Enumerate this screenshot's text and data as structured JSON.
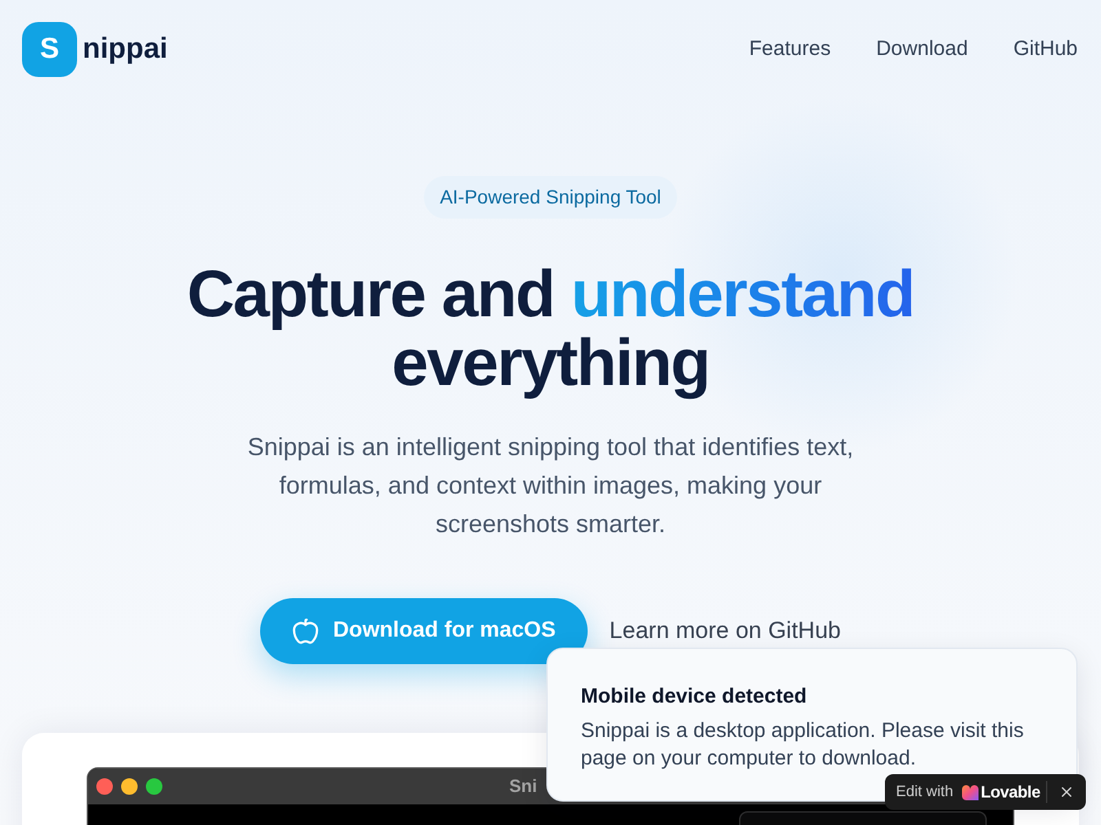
{
  "header": {
    "logo": {
      "mark": "S",
      "name": "nippai"
    },
    "nav": [
      "Features",
      "Download",
      "GitHub"
    ]
  },
  "hero": {
    "badge": "AI-Powered Snipping Tool",
    "title": {
      "before": "Capture and",
      "highlight": "understand",
      "after": "everything"
    },
    "description": "Snippai is an intelligent snipping tool that identifies text, formulas, and context within images, making your screenshots smarter.",
    "buttons": [
      {
        "kind": "primary",
        "label": "Download for macOS"
      },
      {
        "kind": "link",
        "label": "Learn more on GitHub"
      }
    ]
  },
  "preview_window": {
    "title": "Sni"
  },
  "toast": {
    "title": "Mobile device detected",
    "message": "Snippai is a desktop application. Please visit this page on your computer to download."
  },
  "lovable_badge": {
    "prefix": "Edit with",
    "brand": "Lovable"
  }
}
